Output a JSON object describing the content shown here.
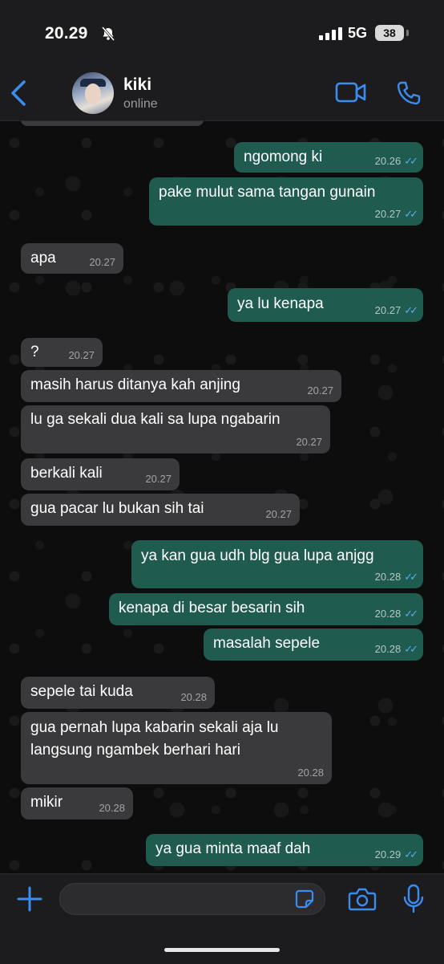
{
  "status_bar": {
    "time": "20.29",
    "network": "5G",
    "battery": "38"
  },
  "header": {
    "contact_name": "kiki",
    "contact_status": "online"
  },
  "messages": [
    {
      "dir": "out",
      "text": "ngomong ki",
      "time": "20.26"
    },
    {
      "dir": "out",
      "text": "pake mulut sama tangan gunain",
      "time": "20.27"
    },
    {
      "dir": "in",
      "text": "apa",
      "time": "20.27"
    },
    {
      "dir": "out",
      "text": "ya lu kenapa",
      "time": "20.27"
    },
    {
      "dir": "in",
      "text": "?",
      "time": "20.27"
    },
    {
      "dir": "in",
      "text": "masih harus ditanya kah anjing",
      "time": "20.27"
    },
    {
      "dir": "in",
      "text": "lu ga sekali dua kali sa lupa ngabarin",
      "time": "20.27"
    },
    {
      "dir": "in",
      "text": "berkali kali",
      "time": "20.27"
    },
    {
      "dir": "in",
      "text": "gua pacar lu bukan sih tai",
      "time": "20.27"
    },
    {
      "dir": "out",
      "text": "ya kan gua udh blg gua lupa anjgg",
      "time": "20.28"
    },
    {
      "dir": "out",
      "text": "kenapa di besar besarin sih",
      "time": "20.28"
    },
    {
      "dir": "out",
      "text": "masalah sepele",
      "time": "20.28"
    },
    {
      "dir": "in",
      "text": "sepele tai kuda",
      "time": "20.28"
    },
    {
      "dir": "in",
      "text": "gua pernah lupa kabarin sekali aja lu\nlangsung ngambek berhari hari",
      "time": "20.28"
    },
    {
      "dir": "in",
      "text": "mikir",
      "time": "20.28"
    },
    {
      "dir": "out",
      "text": "ya gua minta maaf dah",
      "time": "20.29"
    }
  ],
  "input": {
    "placeholder": ""
  },
  "icons": {
    "back": "chevron-left-icon",
    "video": "video-camera-icon",
    "call": "phone-icon",
    "plus": "plus-icon",
    "sticker": "sticker-icon",
    "camera": "camera-icon",
    "mic": "microphone-icon",
    "read_receipt": "double-check-icon"
  },
  "colors": {
    "accent": "#3b8cf0",
    "outgoing_bubble": "#1f5b4e",
    "incoming_bubble": "#3a3a3c",
    "read_ticks": "#5aa9f5"
  }
}
